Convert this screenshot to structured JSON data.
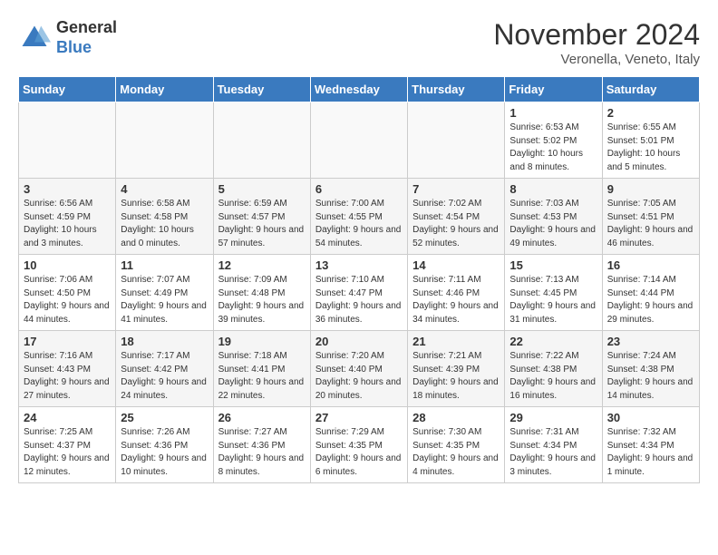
{
  "header": {
    "logo_general": "General",
    "logo_blue": "Blue",
    "month_title": "November 2024",
    "subtitle": "Veronella, Veneto, Italy"
  },
  "weekdays": [
    "Sunday",
    "Monday",
    "Tuesday",
    "Wednesday",
    "Thursday",
    "Friday",
    "Saturday"
  ],
  "weeks": [
    [
      {
        "day": "",
        "info": ""
      },
      {
        "day": "",
        "info": ""
      },
      {
        "day": "",
        "info": ""
      },
      {
        "day": "",
        "info": ""
      },
      {
        "day": "",
        "info": ""
      },
      {
        "day": "1",
        "info": "Sunrise: 6:53 AM\nSunset: 5:02 PM\nDaylight: 10 hours and 8 minutes."
      },
      {
        "day": "2",
        "info": "Sunrise: 6:55 AM\nSunset: 5:01 PM\nDaylight: 10 hours and 5 minutes."
      }
    ],
    [
      {
        "day": "3",
        "info": "Sunrise: 6:56 AM\nSunset: 4:59 PM\nDaylight: 10 hours and 3 minutes."
      },
      {
        "day": "4",
        "info": "Sunrise: 6:58 AM\nSunset: 4:58 PM\nDaylight: 10 hours and 0 minutes."
      },
      {
        "day": "5",
        "info": "Sunrise: 6:59 AM\nSunset: 4:57 PM\nDaylight: 9 hours and 57 minutes."
      },
      {
        "day": "6",
        "info": "Sunrise: 7:00 AM\nSunset: 4:55 PM\nDaylight: 9 hours and 54 minutes."
      },
      {
        "day": "7",
        "info": "Sunrise: 7:02 AM\nSunset: 4:54 PM\nDaylight: 9 hours and 52 minutes."
      },
      {
        "day": "8",
        "info": "Sunrise: 7:03 AM\nSunset: 4:53 PM\nDaylight: 9 hours and 49 minutes."
      },
      {
        "day": "9",
        "info": "Sunrise: 7:05 AM\nSunset: 4:51 PM\nDaylight: 9 hours and 46 minutes."
      }
    ],
    [
      {
        "day": "10",
        "info": "Sunrise: 7:06 AM\nSunset: 4:50 PM\nDaylight: 9 hours and 44 minutes."
      },
      {
        "day": "11",
        "info": "Sunrise: 7:07 AM\nSunset: 4:49 PM\nDaylight: 9 hours and 41 minutes."
      },
      {
        "day": "12",
        "info": "Sunrise: 7:09 AM\nSunset: 4:48 PM\nDaylight: 9 hours and 39 minutes."
      },
      {
        "day": "13",
        "info": "Sunrise: 7:10 AM\nSunset: 4:47 PM\nDaylight: 9 hours and 36 minutes."
      },
      {
        "day": "14",
        "info": "Sunrise: 7:11 AM\nSunset: 4:46 PM\nDaylight: 9 hours and 34 minutes."
      },
      {
        "day": "15",
        "info": "Sunrise: 7:13 AM\nSunset: 4:45 PM\nDaylight: 9 hours and 31 minutes."
      },
      {
        "day": "16",
        "info": "Sunrise: 7:14 AM\nSunset: 4:44 PM\nDaylight: 9 hours and 29 minutes."
      }
    ],
    [
      {
        "day": "17",
        "info": "Sunrise: 7:16 AM\nSunset: 4:43 PM\nDaylight: 9 hours and 27 minutes."
      },
      {
        "day": "18",
        "info": "Sunrise: 7:17 AM\nSunset: 4:42 PM\nDaylight: 9 hours and 24 minutes."
      },
      {
        "day": "19",
        "info": "Sunrise: 7:18 AM\nSunset: 4:41 PM\nDaylight: 9 hours and 22 minutes."
      },
      {
        "day": "20",
        "info": "Sunrise: 7:20 AM\nSunset: 4:40 PM\nDaylight: 9 hours and 20 minutes."
      },
      {
        "day": "21",
        "info": "Sunrise: 7:21 AM\nSunset: 4:39 PM\nDaylight: 9 hours and 18 minutes."
      },
      {
        "day": "22",
        "info": "Sunrise: 7:22 AM\nSunset: 4:38 PM\nDaylight: 9 hours and 16 minutes."
      },
      {
        "day": "23",
        "info": "Sunrise: 7:24 AM\nSunset: 4:38 PM\nDaylight: 9 hours and 14 minutes."
      }
    ],
    [
      {
        "day": "24",
        "info": "Sunrise: 7:25 AM\nSunset: 4:37 PM\nDaylight: 9 hours and 12 minutes."
      },
      {
        "day": "25",
        "info": "Sunrise: 7:26 AM\nSunset: 4:36 PM\nDaylight: 9 hours and 10 minutes."
      },
      {
        "day": "26",
        "info": "Sunrise: 7:27 AM\nSunset: 4:36 PM\nDaylight: 9 hours and 8 minutes."
      },
      {
        "day": "27",
        "info": "Sunrise: 7:29 AM\nSunset: 4:35 PM\nDaylight: 9 hours and 6 minutes."
      },
      {
        "day": "28",
        "info": "Sunrise: 7:30 AM\nSunset: 4:35 PM\nDaylight: 9 hours and 4 minutes."
      },
      {
        "day": "29",
        "info": "Sunrise: 7:31 AM\nSunset: 4:34 PM\nDaylight: 9 hours and 3 minutes."
      },
      {
        "day": "30",
        "info": "Sunrise: 7:32 AM\nSunset: 4:34 PM\nDaylight: 9 hours and 1 minute."
      }
    ]
  ]
}
